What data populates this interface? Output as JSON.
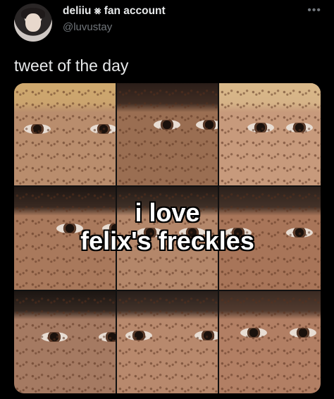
{
  "header": {
    "display_name": "deliiu ⨳ fan account",
    "handle": "@luvustay",
    "more_icon": "more-icon"
  },
  "tweet": {
    "text": "tweet of the day"
  },
  "media": {
    "caption_line1": "i love",
    "caption_line2": "felix's freckles",
    "tiles": [
      {
        "skin": "#b98d6d",
        "hair": "#cfa96e"
      },
      {
        "skin": "#9a6e52",
        "hair": "#2a1d18"
      },
      {
        "skin": "#c79a7c",
        "hair": "#d9b98a"
      },
      {
        "skin": "#a9795c",
        "hair": "#1e1613"
      },
      {
        "skin": "#b4876a",
        "hair": "#221a16"
      },
      {
        "skin": "#a87559",
        "hair": "#2b211c"
      },
      {
        "skin": "#a57a62",
        "hair": "#1b1512"
      },
      {
        "skin": "#b8896d",
        "hair": "#271e1a"
      },
      {
        "skin": "#b27f64",
        "hair": "#3a2a22"
      }
    ]
  }
}
